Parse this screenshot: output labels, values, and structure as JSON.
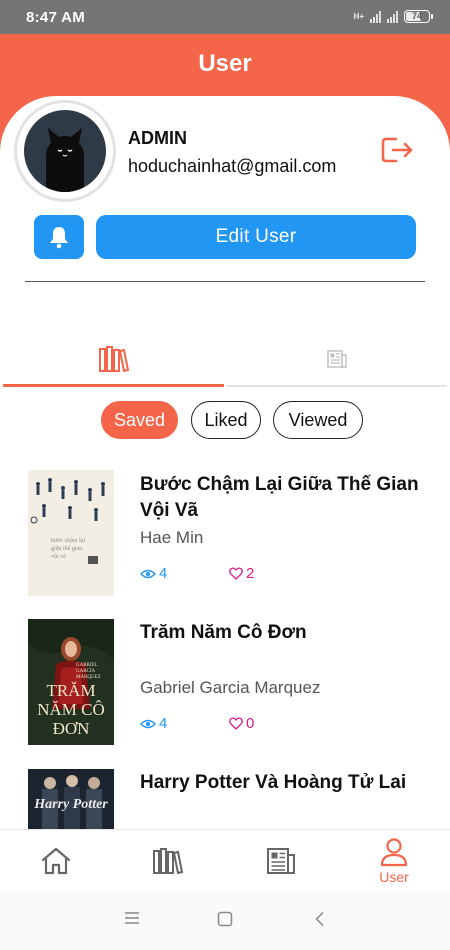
{
  "status_bar": {
    "time": "8:47 AM",
    "network_label": "H+",
    "battery": "74"
  },
  "header": {
    "title": "User"
  },
  "profile": {
    "name": "ADMIN",
    "email": "hoduchainhat@gmail.com",
    "edit_label": "Edit  User"
  },
  "tabs": [
    {
      "name": "library",
      "icon": "books-icon",
      "active": true
    },
    {
      "name": "articles",
      "icon": "newspaper-icon",
      "active": false
    }
  ],
  "filters": [
    {
      "label": "Saved",
      "active": true
    },
    {
      "label": "Liked",
      "active": false
    },
    {
      "label": "Viewed",
      "active": false
    }
  ],
  "books": [
    {
      "title": "Bước Chậm Lại Giữa Thế Gian Vội Vã",
      "author": "Hae Min",
      "views": "4",
      "likes": "2"
    },
    {
      "title": "Trăm Năm Cô Đơn",
      "author": "Gabriel Garcia Marquez",
      "views": "4",
      "likes": "0",
      "cover_text": "TRĂM NĂM CÔ ĐƠN",
      "cover_author": "GABRIEL GARCÍA MÁRQUEZ"
    },
    {
      "title": "Harry Potter Và Hoàng Tử Lai",
      "author": "",
      "views": "",
      "likes": "",
      "cover_text": "Harry Potter"
    }
  ],
  "bottom_nav": [
    {
      "icon": "home-icon",
      "label": ""
    },
    {
      "icon": "books-icon",
      "label": ""
    },
    {
      "icon": "newspaper-icon",
      "label": ""
    },
    {
      "icon": "user-icon",
      "label": "User",
      "active": true
    }
  ],
  "colors": {
    "accent": "#f4654a",
    "primary": "#2196f3",
    "like": "#d81b88"
  }
}
